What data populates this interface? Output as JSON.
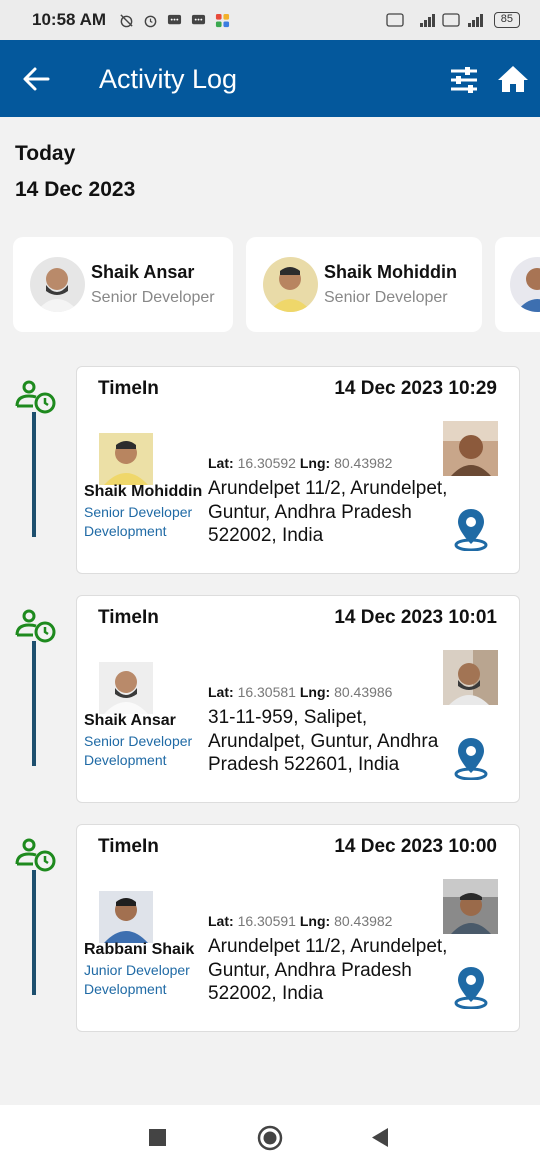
{
  "status_bar": {
    "time": "10:58 AM",
    "battery": "85"
  },
  "app_bar": {
    "title": "Activity Log"
  },
  "header": {
    "today": "Today",
    "date": "14 Dec 2023"
  },
  "users": [
    {
      "name": "Shaik Ansar",
      "role": "Senior Developer"
    },
    {
      "name": "Shaik Mohiddin",
      "role": "Senior Developer"
    }
  ],
  "entries": [
    {
      "type": "TimeIn",
      "datetime": "14 Dec 2023 10:29",
      "name": "Shaik Mohiddin",
      "role": "Senior Developer",
      "department": "Development",
      "lat_label": "Lat:",
      "lat": "16.30592",
      "lng_label": "Lng:",
      "lng": "80.43982",
      "address": "Arundelpet 11/2, Arundelpet, Guntur, Andhra Pradesh 522002, India"
    },
    {
      "type": "TimeIn",
      "datetime": "14 Dec 2023 10:01",
      "name": "Shaik Ansar",
      "role": "Senior Developer",
      "department": "Development",
      "lat_label": "Lat:",
      "lat": "16.30581",
      "lng_label": "Lng:",
      "lng": "80.43986",
      "address": "31-11-959, Salipet, Arundalpet, Guntur, Andhra Pradesh 522601, India"
    },
    {
      "type": "TimeIn",
      "datetime": "14 Dec 2023 10:00",
      "name": "Rabbani Shaik",
      "role": "Junior Developer",
      "department": "Development",
      "lat_label": "Lat:",
      "lat": "16.30591",
      "lng_label": "Lng:",
      "lng": "80.43982",
      "address": "Arundelpet 11/2, Arundelpet, Guntur, Andhra Pradesh 522002, India"
    }
  ],
  "colors": {
    "app_bar": "#04589c",
    "timeline_icon": "#1e8a1e",
    "pin": "#1f6aa5",
    "role_text": "#1f6aa5"
  }
}
